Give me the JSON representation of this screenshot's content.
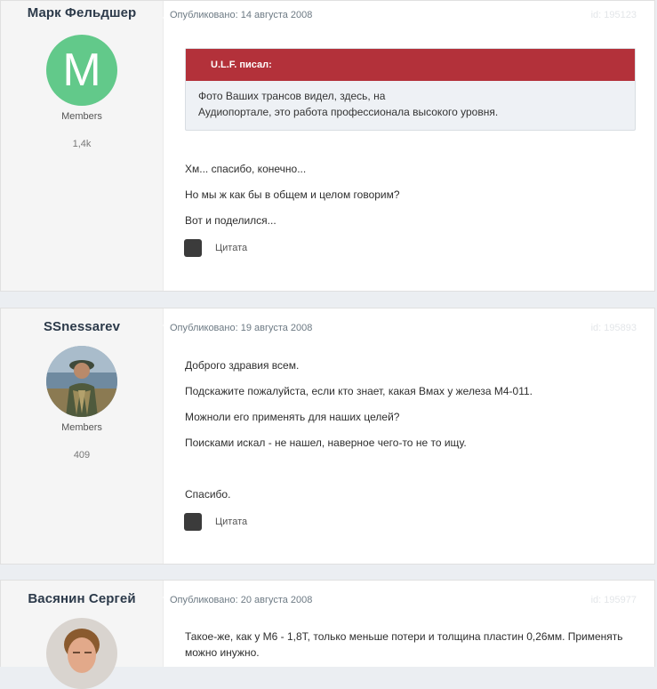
{
  "posts": [
    {
      "author": "Марк Фельдшер",
      "avatar_letter": "M",
      "group": "Members",
      "count": "1,4k",
      "published": "Опубликовано: 14 августа 2008",
      "id": "id: 195123",
      "quote": {
        "header": "U.L.F. писал:",
        "lines": [
          "Фото Ваших трансов видел, здесь, на",
          "Аудиопортале, это работа профессионала высокого уровня."
        ]
      },
      "paragraphs": [
        "Хм... спасибо, конечно...",
        "Но мы ж как бы в общем и целом говорим?",
        "Вот и поделился..."
      ],
      "quote_button": "Цитата"
    },
    {
      "author": "SSnessarev",
      "group": "Members",
      "count": "409",
      "published": "Опубликовано: 19 августа 2008",
      "id": "id: 195893",
      "paragraphs": [
        "Доброго здравия всем.",
        "Подскажите пожалуйста, если кто знает, какая Bмах у железа М4-011.",
        "Можноли его применять для наших целей?",
        "Поисками искал - не нашел, наверное чего-то не то ищу.",
        "Спасибо."
      ],
      "quote_button": "Цитата"
    },
    {
      "author": "Васянин Сергей",
      "published": "Опубликовано: 20 августа 2008",
      "id": "id: 195977",
      "paragraphs": [
        "Такое-же, как у М6 - 1,8Т, только меньше потери и толщина пластин 0,26мм. Применять можно инужно."
      ]
    }
  ]
}
